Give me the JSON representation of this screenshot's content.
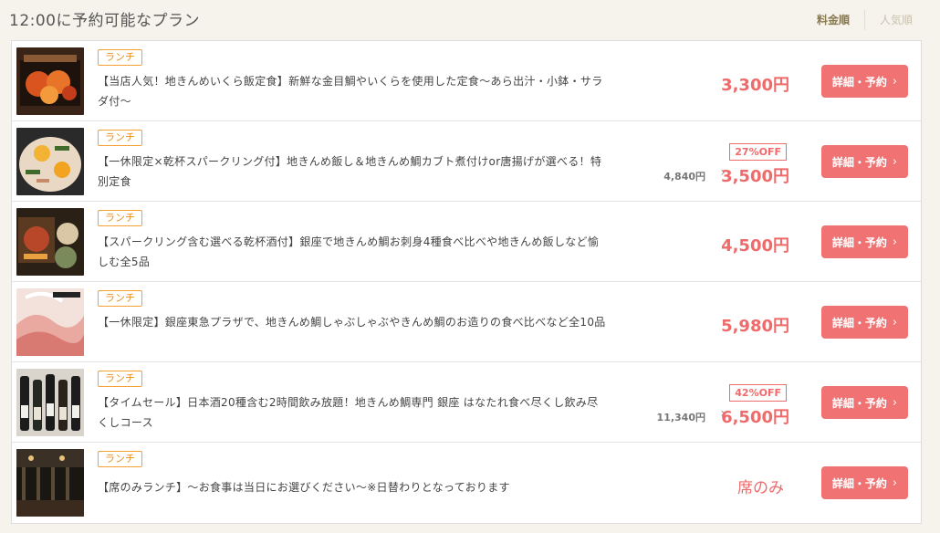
{
  "header": {
    "title": "12:00に予約可能なプラン",
    "sort_price": "料金順",
    "sort_popular": "人気順"
  },
  "plans": [
    {
      "badge": "ランチ",
      "title": "【当店人気！地きんめいくら飯定食】新鮮な金目鯛やいくらを使用した定食〜あら出汁・小鉢・サラダ付〜",
      "price": "3,300円",
      "button": "詳細・予約"
    },
    {
      "badge": "ランチ",
      "title": "【一休限定×乾杯スパークリング付】地きんめ飯し＆地きんめ鯛カブト煮付けor唐揚げが選べる！特別定食",
      "discount": "27%OFF",
      "original_price": "4,840円",
      "price": "3,500円",
      "button": "詳細・予約"
    },
    {
      "badge": "ランチ",
      "title": "【スパークリング含む選べる乾杯酒付】銀座で地きんめ鯛お刺身4種食べ比べや地きんめ飯しなど愉しむ全5品",
      "price": "4,500円",
      "button": "詳細・予約"
    },
    {
      "badge": "ランチ",
      "title": "【一休限定】銀座東急プラザで、地きんめ鯛しゃぶしゃぶやきんめ鯛のお造りの食べ比べなど全10品",
      "price": "5,980円",
      "button": "詳細・予約"
    },
    {
      "badge": "ランチ",
      "title": "【タイムセール】日本酒20種含む2時間飲み放題！地きんめ鯛専門 銀座 はなたれ食べ尽くし飲み尽くしコース",
      "discount": "42%OFF",
      "original_price": "11,340円",
      "price": "6,500円",
      "button": "詳細・予約"
    },
    {
      "badge": "ランチ",
      "title": "【席のみランチ】〜お食事は当日にお選びください〜※日替わりとなっております",
      "price": "席のみ",
      "button": "詳細・予約"
    }
  ],
  "icons": {
    "chevron": "chevron-right-icon"
  },
  "colors": {
    "accent": "#f07272",
    "badge": "#f2a132",
    "sort_active": "#8a7a52"
  }
}
